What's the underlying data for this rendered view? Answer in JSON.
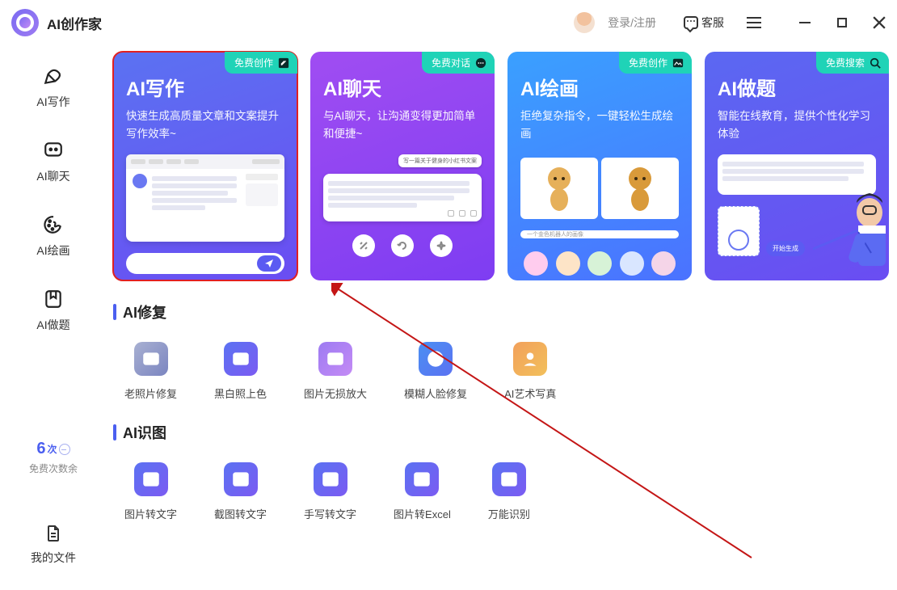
{
  "titlebar": {
    "app_name": "AI创作家",
    "login": "登录/注册",
    "support": "客服"
  },
  "sidebar": {
    "items": [
      {
        "label": "AI写作"
      },
      {
        "label": "AI聊天"
      },
      {
        "label": "AI绘画"
      },
      {
        "label": "AI做题"
      }
    ],
    "free": {
      "count": "6",
      "unit": "次",
      "label": "免费次数余"
    },
    "my_files": "我的文件"
  },
  "cards": [
    {
      "title": "AI写作",
      "badge": "免费创作",
      "desc": "快速生成高质量文章和文案提升写作效率~"
    },
    {
      "title": "AI聊天",
      "badge": "免费对话",
      "desc": "与AI聊天，让沟通变得更加简单和便捷~"
    },
    {
      "title": "AI绘画",
      "badge": "免费创作",
      "desc": "拒绝复杂指令，一键轻松生成绘画"
    },
    {
      "title": "AI做题",
      "badge": "免费搜索",
      "desc": "智能在线教育，提供个性化学习体验"
    }
  ],
  "card_extra": {
    "chat_bubble": "写一篇关于健身的小红书文案",
    "draw_prompt": "一个金色机器人的画像",
    "gen_btn": "开始生成"
  },
  "sections": {
    "repair": {
      "title": "AI修复",
      "items": [
        "老照片修复",
        "黑白照上色",
        "图片无损放大",
        "模糊人脸修复",
        "AI艺术写真"
      ]
    },
    "ocr": {
      "title": "AI识图",
      "items": [
        "图片转文字",
        "截图转文字",
        "手写转文字",
        "图片转Excel",
        "万能识别"
      ]
    }
  }
}
